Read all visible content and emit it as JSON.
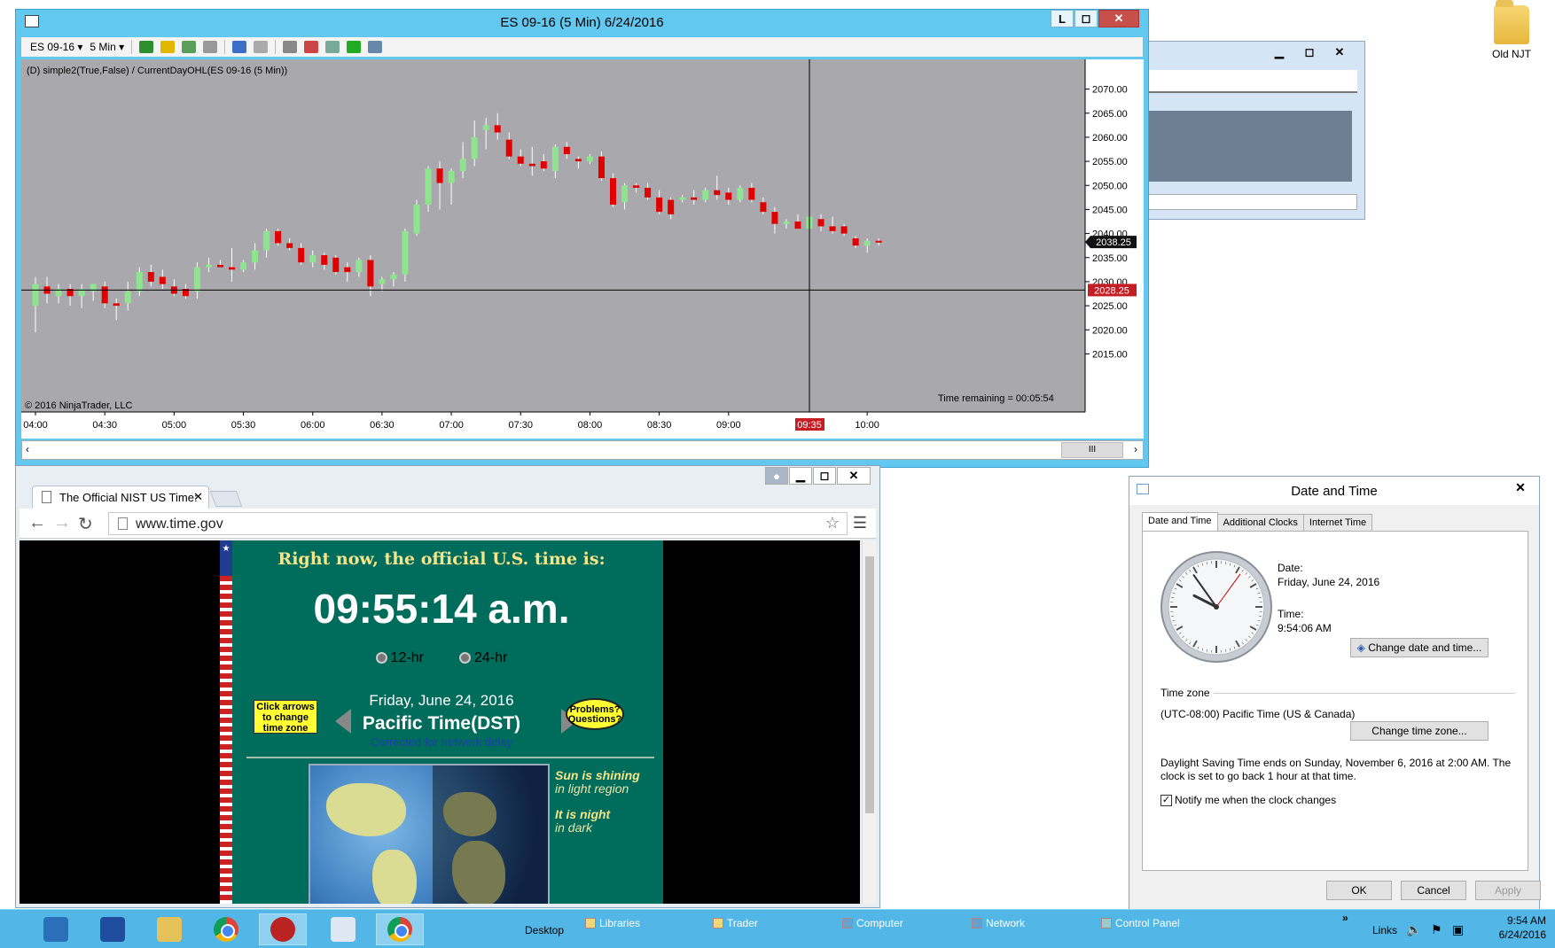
{
  "desktop": {
    "folder_label": "Old NJT"
  },
  "chart_window": {
    "title": "ES 09-16 (5 Min)  6/24/2016",
    "window_controls": {
      "l_label": "L"
    },
    "toolbar": {
      "instrument": "ES 09-16",
      "interval": "5 Min"
    },
    "indicator_label": "(D) simple2(True,False) / CurrentDayOHL(ES 09-16 (5 Min))",
    "copyright": "© 2016 NinjaTrader, LLC",
    "time_remaining": "Time remaining = 00:05:54",
    "price_ticks": [
      "2070.00",
      "2065.00",
      "2060.00",
      "2055.00",
      "2050.00",
      "2045.00",
      "2040.00",
      "2035.00",
      "2030.00",
      "2025.00",
      "2020.00",
      "2015.00"
    ],
    "time_ticks": [
      "04:00",
      "04:30",
      "05:00",
      "05:30",
      "06:00",
      "06:30",
      "07:00",
      "07:30",
      "08:00",
      "08:30",
      "09:00",
      "09:35",
      "10:00"
    ],
    "last_price_label": "2038.25",
    "crosshair_price_label": "2028.25",
    "crosshair_time_label": "09:35",
    "colors": {
      "background": "#a9a9ad",
      "up": "#8fe48f",
      "down": "#e00000",
      "crosshair_tag": "#c41d24"
    }
  },
  "chart_data": {
    "type": "candlestick",
    "xlabel": "",
    "ylabel": "",
    "ylim": [
      2012.5,
      2072.5
    ],
    "candles": [
      {
        "t": "04:00",
        "o": 2025.0,
        "h": 2031.0,
        "l": 2019.5,
        "c": 2029.5
      },
      {
        "t": "04:05",
        "o": 2029.0,
        "h": 2031.0,
        "l": 2025.5,
        "c": 2027.5
      },
      {
        "t": "04:10",
        "o": 2027.0,
        "h": 2029.5,
        "l": 2025.5,
        "c": 2028.5
      },
      {
        "t": "04:15",
        "o": 2028.5,
        "h": 2029.5,
        "l": 2025.0,
        "c": 2027.0
      },
      {
        "t": "04:20",
        "o": 2027.0,
        "h": 2029.5,
        "l": 2024.5,
        "c": 2028.5
      },
      {
        "t": "04:25",
        "o": 2028.0,
        "h": 2029.5,
        "l": 2026.0,
        "c": 2029.5
      },
      {
        "t": "04:30",
        "o": 2029.0,
        "h": 2030.0,
        "l": 2024.5,
        "c": 2025.5
      },
      {
        "t": "04:35",
        "o": 2025.5,
        "h": 2026.5,
        "l": 2022.0,
        "c": 2025.0
      },
      {
        "t": "04:40",
        "o": 2025.5,
        "h": 2030.0,
        "l": 2024.0,
        "c": 2028.0
      },
      {
        "t": "04:45",
        "o": 2028.0,
        "h": 2033.0,
        "l": 2027.0,
        "c": 2032.0
      },
      {
        "t": "04:50",
        "o": 2032.0,
        "h": 2033.5,
        "l": 2029.0,
        "c": 2030.0
      },
      {
        "t": "04:55",
        "o": 2031.0,
        "h": 2032.5,
        "l": 2028.5,
        "c": 2029.5
      },
      {
        "t": "05:00",
        "o": 2029.0,
        "h": 2030.5,
        "l": 2027.0,
        "c": 2027.5
      },
      {
        "t": "05:05",
        "o": 2028.5,
        "h": 2029.5,
        "l": 2026.5,
        "c": 2027.0
      },
      {
        "t": "05:10",
        "o": 2028.0,
        "h": 2034.0,
        "l": 2026.5,
        "c": 2033.0
      },
      {
        "t": "05:15",
        "o": 2033.0,
        "h": 2035.0,
        "l": 2032.0,
        "c": 2033.5
      },
      {
        "t": "05:20",
        "o": 2033.5,
        "h": 2034.5,
        "l": 2033.0,
        "c": 2033.0
      },
      {
        "t": "05:25",
        "o": 2033.0,
        "h": 2037.0,
        "l": 2030.0,
        "c": 2032.5
      },
      {
        "t": "05:30",
        "o": 2032.5,
        "h": 2034.5,
        "l": 2032.0,
        "c": 2034.0
      },
      {
        "t": "05:35",
        "o": 2034.0,
        "h": 2038.0,
        "l": 2032.5,
        "c": 2036.5
      },
      {
        "t": "05:40",
        "o": 2036.5,
        "h": 2041.0,
        "l": 2035.0,
        "c": 2040.5
      },
      {
        "t": "05:45",
        "o": 2040.5,
        "h": 2041.0,
        "l": 2037.5,
        "c": 2038.0
      },
      {
        "t": "05:50",
        "o": 2038.0,
        "h": 2039.0,
        "l": 2036.5,
        "c": 2037.0
      },
      {
        "t": "05:55",
        "o": 2037.0,
        "h": 2038.0,
        "l": 2033.5,
        "c": 2034.0
      },
      {
        "t": "06:00",
        "o": 2034.0,
        "h": 2036.5,
        "l": 2033.0,
        "c": 2035.5
      },
      {
        "t": "06:05",
        "o": 2035.5,
        "h": 2036.0,
        "l": 2032.5,
        "c": 2033.5
      },
      {
        "t": "06:10",
        "o": 2035.0,
        "h": 2035.5,
        "l": 2031.5,
        "c": 2032.0
      },
      {
        "t": "06:15",
        "o": 2033.0,
        "h": 2034.0,
        "l": 2030.0,
        "c": 2032.0
      },
      {
        "t": "06:20",
        "o": 2032.0,
        "h": 2035.0,
        "l": 2031.0,
        "c": 2034.5
      },
      {
        "t": "06:25",
        "o": 2034.5,
        "h": 2035.5,
        "l": 2027.0,
        "c": 2029.0
      },
      {
        "t": "06:30",
        "o": 2029.5,
        "h": 2031.0,
        "l": 2028.0,
        "c": 2030.5
      },
      {
        "t": "06:35",
        "o": 2030.5,
        "h": 2032.0,
        "l": 2029.0,
        "c": 2031.5
      },
      {
        "t": "06:40",
        "o": 2031.5,
        "h": 2041.0,
        "l": 2030.0,
        "c": 2040.5
      },
      {
        "t": "06:45",
        "o": 2040.0,
        "h": 2047.0,
        "l": 2039.5,
        "c": 2046.0
      },
      {
        "t": "06:50",
        "o": 2046.0,
        "h": 2054.0,
        "l": 2044.5,
        "c": 2053.5
      },
      {
        "t": "06:55",
        "o": 2053.5,
        "h": 2055.0,
        "l": 2045.0,
        "c": 2050.5
      },
      {
        "t": "07:00",
        "o": 2050.5,
        "h": 2053.5,
        "l": 2046.0,
        "c": 2053.0
      },
      {
        "t": "07:05",
        "o": 2053.0,
        "h": 2059.0,
        "l": 2051.5,
        "c": 2055.5
      },
      {
        "t": "07:10",
        "o": 2055.5,
        "h": 2063.5,
        "l": 2054.0,
        "c": 2060.0
      },
      {
        "t": "07:15",
        "o": 2061.5,
        "h": 2064.0,
        "l": 2057.5,
        "c": 2062.5
      },
      {
        "t": "07:20",
        "o": 2062.5,
        "h": 2065.0,
        "l": 2059.5,
        "c": 2061.0
      },
      {
        "t": "07:25",
        "o": 2059.5,
        "h": 2061.0,
        "l": 2055.5,
        "c": 2056.0
      },
      {
        "t": "07:30",
        "o": 2056.0,
        "h": 2057.5,
        "l": 2054.0,
        "c": 2054.5
      },
      {
        "t": "07:35",
        "o": 2054.5,
        "h": 2058.0,
        "l": 2052.0,
        "c": 2054.0
      },
      {
        "t": "07:40",
        "o": 2055.0,
        "h": 2056.5,
        "l": 2053.0,
        "c": 2053.5
      },
      {
        "t": "07:45",
        "o": 2053.0,
        "h": 2058.5,
        "l": 2051.5,
        "c": 2058.0
      },
      {
        "t": "07:50",
        "o": 2058.0,
        "h": 2059.0,
        "l": 2055.5,
        "c": 2056.5
      },
      {
        "t": "07:55",
        "o": 2055.5,
        "h": 2056.0,
        "l": 2053.5,
        "c": 2055.0
      },
      {
        "t": "08:00",
        "o": 2055.0,
        "h": 2056.5,
        "l": 2054.5,
        "c": 2056.0
      },
      {
        "t": "08:05",
        "o": 2056.0,
        "h": 2057.0,
        "l": 2051.0,
        "c": 2051.5
      },
      {
        "t": "08:10",
        "o": 2051.5,
        "h": 2052.5,
        "l": 2045.5,
        "c": 2046.0
      },
      {
        "t": "08:15",
        "o": 2046.5,
        "h": 2050.5,
        "l": 2045.0,
        "c": 2050.0
      },
      {
        "t": "08:20",
        "o": 2050.0,
        "h": 2050.5,
        "l": 2048.5,
        "c": 2049.5
      },
      {
        "t": "08:25",
        "o": 2049.5,
        "h": 2050.5,
        "l": 2047.0,
        "c": 2047.5
      },
      {
        "t": "08:30",
        "o": 2047.5,
        "h": 2049.0,
        "l": 2044.0,
        "c": 2044.5
      },
      {
        "t": "08:35",
        "o": 2047.0,
        "h": 2047.5,
        "l": 2043.0,
        "c": 2044.0
      },
      {
        "t": "08:40",
        "o": 2047.0,
        "h": 2048.0,
        "l": 2046.5,
        "c": 2047.5
      },
      {
        "t": "08:45",
        "o": 2047.5,
        "h": 2049.0,
        "l": 2046.0,
        "c": 2047.0
      },
      {
        "t": "08:50",
        "o": 2047.0,
        "h": 2049.5,
        "l": 2046.5,
        "c": 2049.0
      },
      {
        "t": "08:55",
        "o": 2049.0,
        "h": 2052.0,
        "l": 2047.0,
        "c": 2048.0
      },
      {
        "t": "09:00",
        "o": 2048.5,
        "h": 2049.5,
        "l": 2046.0,
        "c": 2047.0
      },
      {
        "t": "09:05",
        "o": 2047.0,
        "h": 2050.0,
        "l": 2046.5,
        "c": 2049.5
      },
      {
        "t": "09:10",
        "o": 2049.5,
        "h": 2050.5,
        "l": 2046.5,
        "c": 2047.0
      },
      {
        "t": "09:15",
        "o": 2046.5,
        "h": 2047.5,
        "l": 2044.0,
        "c": 2044.5
      },
      {
        "t": "09:20",
        "o": 2044.5,
        "h": 2045.5,
        "l": 2040.0,
        "c": 2042.0
      },
      {
        "t": "09:25",
        "o": 2042.0,
        "h": 2043.0,
        "l": 2041.0,
        "c": 2042.5
      },
      {
        "t": "09:30",
        "o": 2042.5,
        "h": 2044.0,
        "l": 2041.0,
        "c": 2041.0
      },
      {
        "t": "09:35",
        "o": 2041.0,
        "h": 2044.5,
        "l": 2040.5,
        "c": 2043.5
      },
      {
        "t": "09:40",
        "o": 2043.0,
        "h": 2044.0,
        "l": 2040.5,
        "c": 2041.5
      },
      {
        "t": "09:45",
        "o": 2041.5,
        "h": 2043.5,
        "l": 2040.0,
        "c": 2040.5
      },
      {
        "t": "09:50",
        "o": 2041.5,
        "h": 2042.0,
        "l": 2039.5,
        "c": 2040.0
      },
      {
        "t": "09:55",
        "o": 2039.0,
        "h": 2039.5,
        "l": 2037.0,
        "c": 2037.5
      },
      {
        "t": "10:00",
        "o": 2037.5,
        "h": 2039.0,
        "l": 2036.0,
        "c": 2038.5
      },
      {
        "t": "10:05",
        "o": 2038.5,
        "h": 2039.0,
        "l": 2037.5,
        "c": 2038.25
      }
    ]
  },
  "browser": {
    "tab_title": "The Official NIST US Time:",
    "url": "www.time.gov",
    "page": {
      "header": "Right now, the official U.S. time is:",
      "time": "09:55:14 a.m.",
      "format_12": "12-hr",
      "format_24": "24-hr",
      "date": "Friday, June 24, 2016",
      "timezone": "Pacific Time(DST)",
      "correction": "Corrected for network delay",
      "click_arrows": "Click arrows to change time zone",
      "problems": "Problems? Questions?",
      "sun_text": "Sun is shining",
      "sun_sub": "in light region",
      "night_text": "It is night",
      "night_sub": "in dark"
    }
  },
  "date_time_dialog": {
    "title": "Date and Time",
    "tabs": [
      "Date and Time",
      "Additional Clocks",
      "Internet Time"
    ],
    "date_label": "Date:",
    "date_value": "Friday, June 24, 2016",
    "time_label": "Time:",
    "time_value": "9:54:06 AM",
    "change_date_button": "Change date and time...",
    "time_zone_label": "Time zone",
    "time_zone_value": "(UTC-08:00) Pacific Time (US & Canada)",
    "change_zone_button": "Change time zone...",
    "dst_text": "Daylight Saving Time ends on Sunday, November 6, 2016 at 2:00 AM. The clock is set to go back 1 hour at that time.",
    "notify_label": "Notify me when the clock changes",
    "notify_checked": true,
    "ok": "OK",
    "cancel": "Cancel",
    "apply": "Apply",
    "clock": {
      "hour": 9,
      "minute": 54,
      "second": 6
    }
  },
  "taskbar": {
    "links": [
      "Desktop",
      "Libraries",
      "Trader",
      "Computer",
      "Network",
      "Control Panel"
    ],
    "links_label": "Links",
    "clock_time": "9:54 AM",
    "clock_date": "6/24/2016",
    "overflow": "»"
  }
}
